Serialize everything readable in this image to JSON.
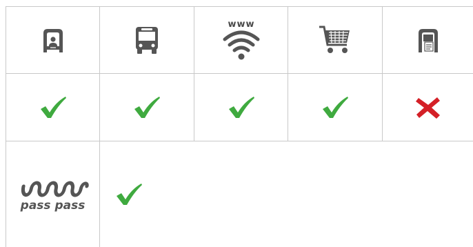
{
  "icons": {
    "desk": "ticket-desk-icon",
    "bus": "bus-icon",
    "web": "web-wifi-icon",
    "web_label": "www",
    "shop": "shopping-cart-icon",
    "machine": "ticket-machine-icon"
  },
  "availability": [
    {
      "channel": "desk",
      "available": true
    },
    {
      "channel": "bus",
      "available": true
    },
    {
      "channel": "web",
      "available": true
    },
    {
      "channel": "shop",
      "available": true
    },
    {
      "channel": "machine",
      "available": false
    }
  ],
  "pass_pass": {
    "brand_text": "pass pass",
    "available": true
  },
  "colors": {
    "check": "#3faa3f",
    "cross": "#d42027",
    "icon": "#555555",
    "grid": "#c8c8c8"
  }
}
